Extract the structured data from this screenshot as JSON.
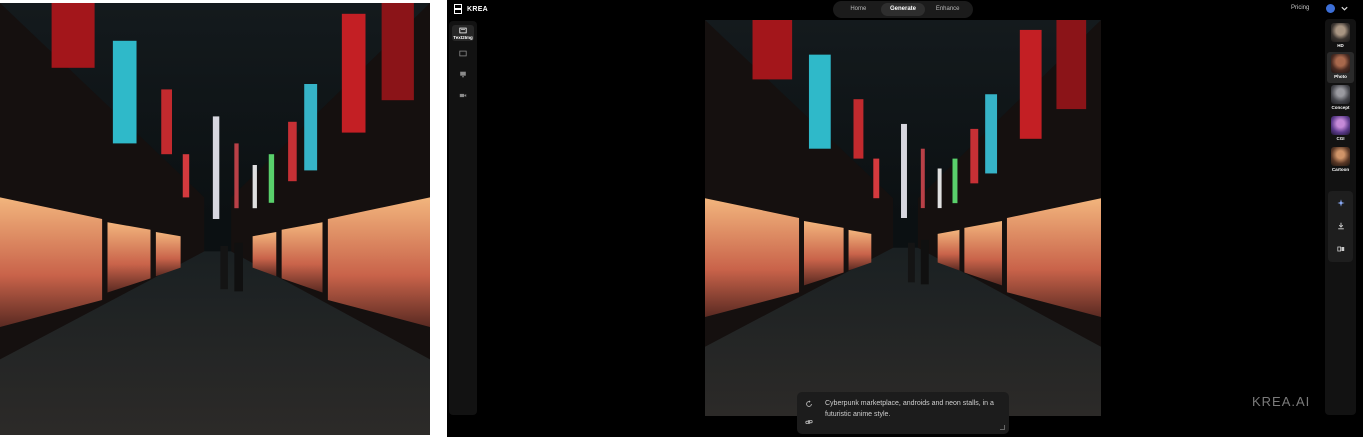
{
  "app": {
    "brand": "KREA",
    "nav_tabs": [
      {
        "label": "Home",
        "active": false
      },
      {
        "label": "Generate",
        "active": true
      },
      {
        "label": "Enhance",
        "active": false
      }
    ],
    "pricing_label": "Pricing",
    "watermark": "KREA.AI"
  },
  "left_tools": [
    {
      "icon": "text-image-icon",
      "label": "Text2Img",
      "active": true
    },
    {
      "icon": "image-icon",
      "label": "",
      "active": false
    },
    {
      "icon": "monitor-icon",
      "label": "",
      "active": false
    },
    {
      "icon": "video-icon",
      "label": "",
      "active": false
    }
  ],
  "prompt": {
    "text": "Cyberpunk marketplace, androids and neon stalls, in a futuristic anime style.",
    "buttons": [
      "refresh-icon",
      "link-icon"
    ]
  },
  "styles": [
    {
      "label": "HD",
      "active": false
    },
    {
      "label": "Photo",
      "active": true
    },
    {
      "label": "Concept",
      "active": false
    },
    {
      "label": "CGI",
      "active": false
    },
    {
      "label": "Cartoon",
      "active": false
    }
  ],
  "actions": [
    "sparkle-icon",
    "download-icon",
    "compare-icon"
  ],
  "colors": {
    "background": "#000000",
    "panel": "#121212",
    "accent": "#3c6fd8",
    "neon_red": "#d8292c",
    "neon_cyan": "#38c6d8"
  }
}
